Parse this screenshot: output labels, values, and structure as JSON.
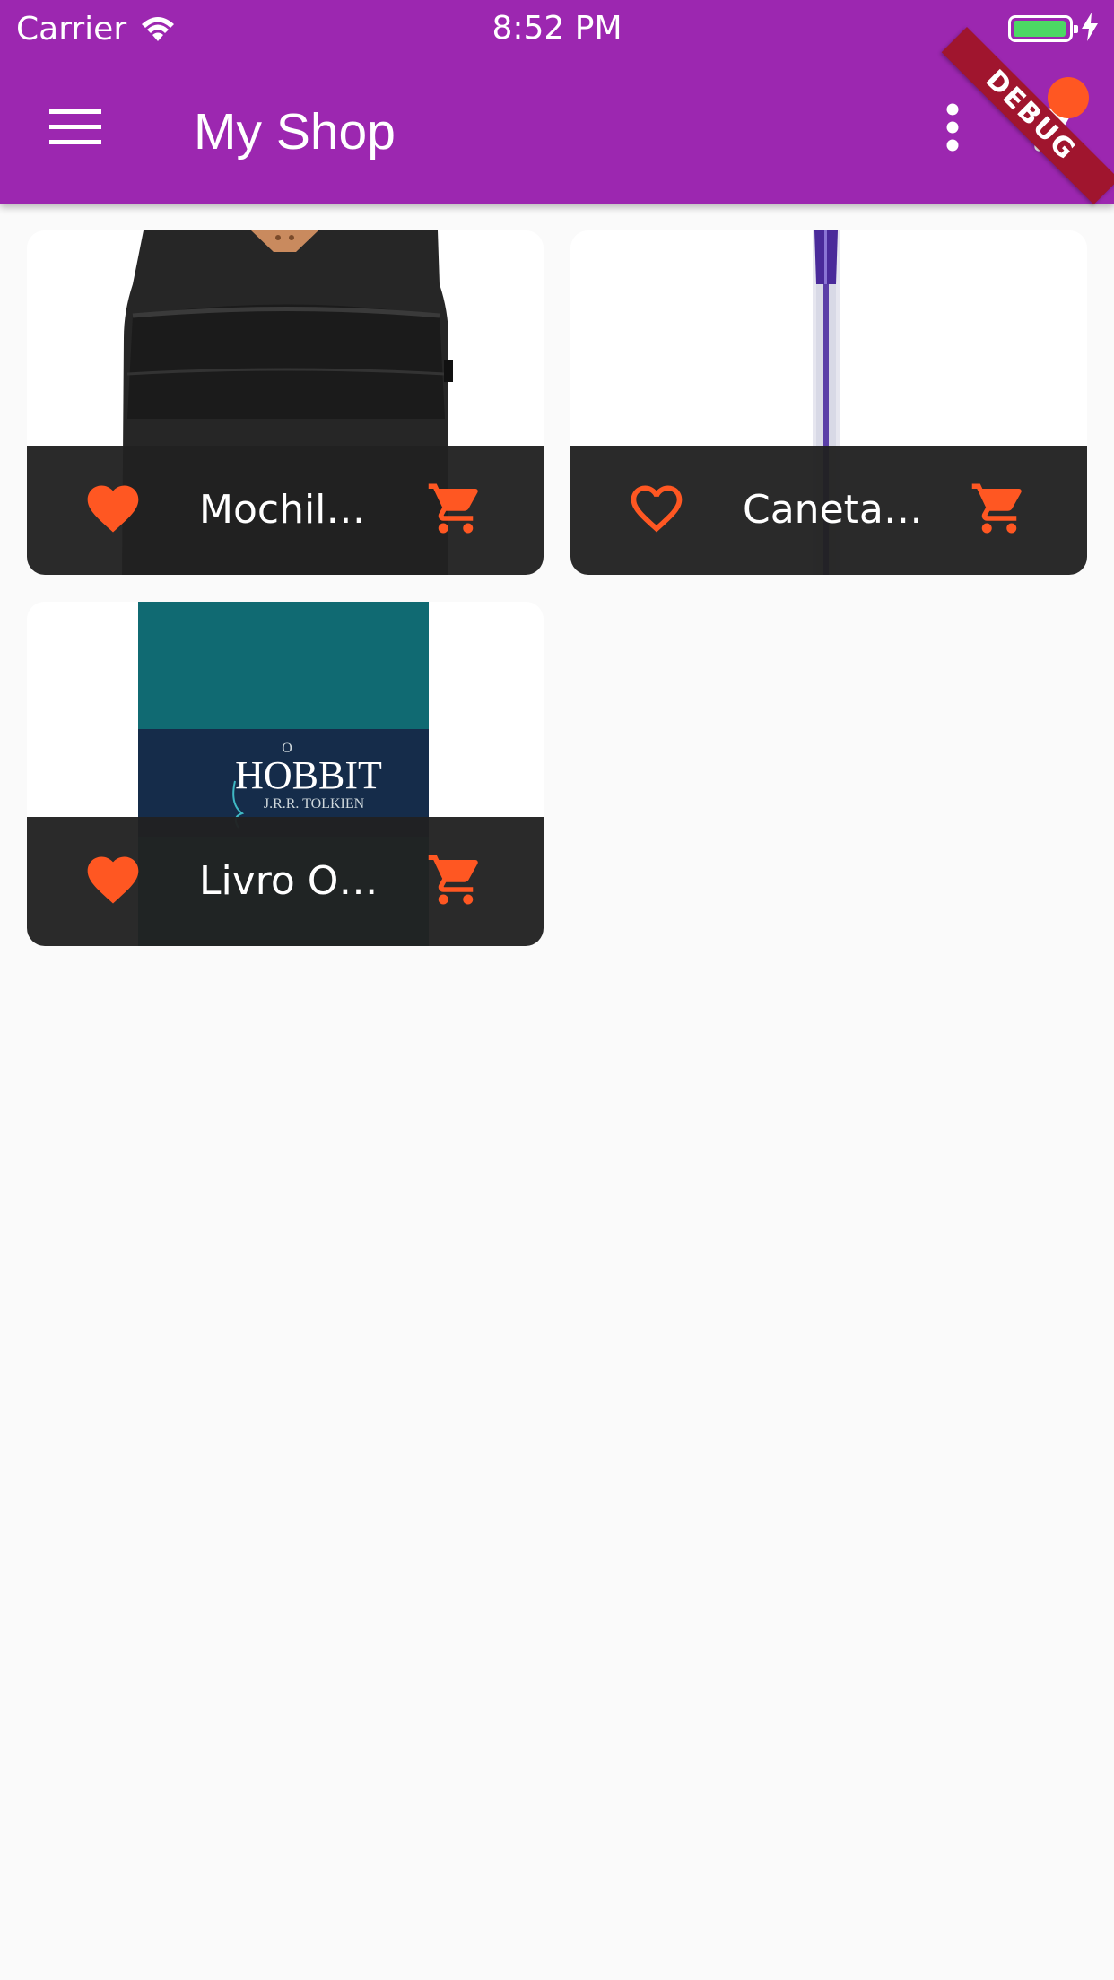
{
  "status_bar": {
    "carrier": "Carrier",
    "time": "8:52 PM"
  },
  "app_bar": {
    "title": "My Shop",
    "background_color": "#9c27b0",
    "menu_icon": "hamburger-menu-icon",
    "more_icon": "more-vert-icon",
    "cart_icon": "shopping-cart-icon"
  },
  "debug_banner": "DEBUG",
  "accent_color": "#ff5722",
  "products": [
    {
      "name": "Mochila...",
      "favorite": true,
      "image": "black-backpack"
    },
    {
      "name": "Caneta ...",
      "favorite": false,
      "image": "blue-pen"
    },
    {
      "name": "Livro O ...",
      "favorite": true,
      "image": "hobbit-book",
      "book_title": "HOBBIT",
      "book_prefix": "O",
      "book_author": "J.R.R. TOLKIEN"
    }
  ]
}
